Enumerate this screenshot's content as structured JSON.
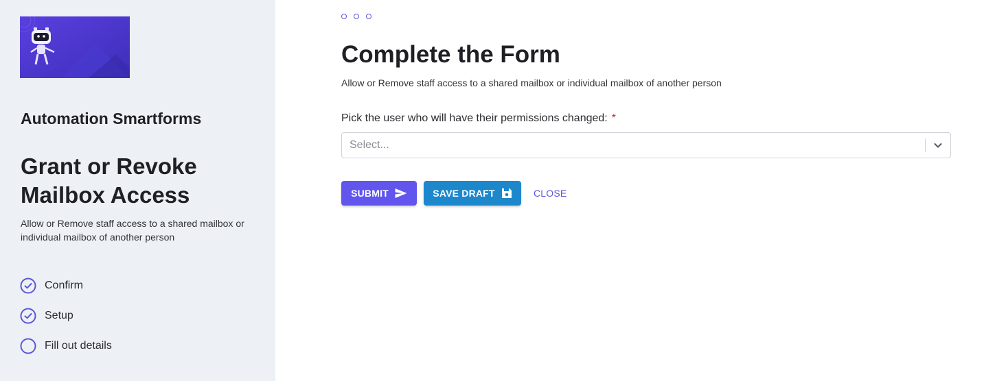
{
  "sidebar": {
    "logo_icon": "robot-mascot-icon",
    "app_name": "Automation Smartforms",
    "form_title": "Grant or Revoke Mailbox Access",
    "form_description": "Allow or Remove staff access to a shared mailbox or individual mailbox of another person",
    "steps": [
      {
        "label": "Confirm",
        "status": "completed",
        "icon": "check-circle-icon"
      },
      {
        "label": "Setup",
        "status": "completed",
        "icon": "check-circle-icon"
      },
      {
        "label": "Fill out details",
        "status": "current",
        "icon": "empty-circle-icon"
      }
    ]
  },
  "main": {
    "progress_dots": 3,
    "title": "Complete the Form",
    "subtitle": "Allow or Remove staff access to a shared mailbox or individual mailbox of another person",
    "field": {
      "label": "Pick the user who will have their permissions changed:",
      "required_marker": "*",
      "placeholder": "Select...",
      "value": ""
    },
    "actions": {
      "submit_label": "SUBMIT",
      "submit_icon": "send-icon",
      "draft_label": "SAVE DRAFT",
      "draft_icon": "save-floppy-icon",
      "close_label": "CLOSE"
    }
  },
  "colors": {
    "accent": "#5b57d6",
    "submit_bg": "#6155ee",
    "draft_bg": "#1d87cc",
    "sidebar_bg": "#edf1f5",
    "required": "#d12c2c"
  }
}
